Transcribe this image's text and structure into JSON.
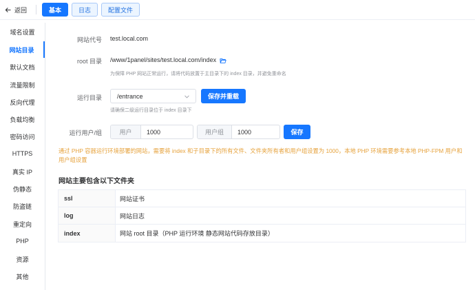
{
  "header": {
    "back_label": "返回",
    "tabs": [
      {
        "label": "基本",
        "active": true
      },
      {
        "label": "日志",
        "active": false
      },
      {
        "label": "配置文件",
        "active": false
      }
    ]
  },
  "sidebar": {
    "items": [
      {
        "label": "域名设置",
        "active": false
      },
      {
        "label": "网站目录",
        "active": true
      },
      {
        "label": "默认文档",
        "active": false
      },
      {
        "label": "流量限制",
        "active": false
      },
      {
        "label": "反向代理",
        "active": false
      },
      {
        "label": "负载均衡",
        "active": false
      },
      {
        "label": "密码访问",
        "active": false
      },
      {
        "label": "HTTPS",
        "active": false
      },
      {
        "label": "真实 IP",
        "active": false
      },
      {
        "label": "伪静态",
        "active": false
      },
      {
        "label": "防盗链",
        "active": false
      },
      {
        "label": "重定向",
        "active": false
      },
      {
        "label": "PHP",
        "active": false
      },
      {
        "label": "资源",
        "active": false
      },
      {
        "label": "其他",
        "active": false
      }
    ]
  },
  "form": {
    "site_code_label": "网站代号",
    "site_code_value": "test.local.com",
    "root_label": "root 目录",
    "root_value": "/www/1panel/sites/test.local.com/index",
    "root_hint": "为保障 PHP 网站正常运行，请将代码放置于主目录下的 index 目录，并避免重命名",
    "run_dir_label": "运行目录",
    "run_dir_value": "/entrance",
    "run_dir_button": "保存并重载",
    "run_dir_hint": "请确保二级运行目录位于 index 目录下",
    "run_user_label": "运行用户/组",
    "user_prefix": "用户",
    "user_value": "1000",
    "group_prefix": "用户组",
    "group_value": "1000",
    "save_button": "保存"
  },
  "warning": "通过 PHP 容器运行环境部署的网站，需要将 index 和子目录下的所有文件、文件夹所有者和用户组设置为 1000，本地 PHP 环境需要参考本地 PHP-FPM 用户和用户组设置",
  "folders": {
    "title": "网站主要包含以下文件夹",
    "rows": [
      {
        "name": "ssl",
        "desc": "网站证书"
      },
      {
        "name": "log",
        "desc": "网站日志"
      },
      {
        "name": "index",
        "desc": "网站 root 目录（PHP 运行环境 静态网站代码存放目录）"
      }
    ]
  },
  "colors": {
    "primary": "#1677ff",
    "warning": "#e6a23c"
  }
}
